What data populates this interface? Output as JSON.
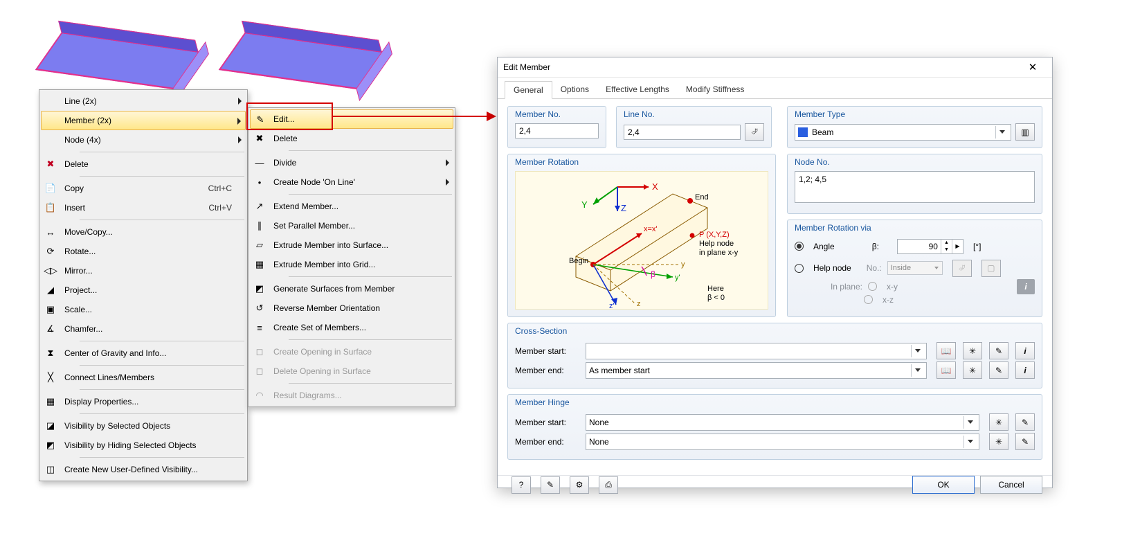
{
  "beams_count": 2,
  "context_menu_1": {
    "items": [
      {
        "label": "Line (2x)",
        "icon": "",
        "sub": true
      },
      {
        "label": "Member (2x)",
        "icon": "",
        "sub": true,
        "hover": true
      },
      {
        "label": "Node (4x)",
        "icon": "",
        "sub": true
      },
      {
        "sep": true
      },
      {
        "label": "Delete",
        "icon": "✖",
        "iconColor": "#C00020"
      },
      {
        "sep": true
      },
      {
        "label": "Copy",
        "icon": "📄",
        "accel": "Ctrl+C"
      },
      {
        "label": "Insert",
        "icon": "📋",
        "accel": "Ctrl+V"
      },
      {
        "sep": true
      },
      {
        "label": "Move/Copy...",
        "icon": "↔"
      },
      {
        "label": "Rotate...",
        "icon": "⟳"
      },
      {
        "label": "Mirror...",
        "icon": "◁▷"
      },
      {
        "label": "Project...",
        "icon": "◢"
      },
      {
        "label": "Scale...",
        "icon": "▣"
      },
      {
        "label": "Chamfer...",
        "icon": "∡"
      },
      {
        "sep": true
      },
      {
        "label": "Center of Gravity and Info...",
        "icon": "⧗"
      },
      {
        "sep": true
      },
      {
        "label": "Connect Lines/Members",
        "icon": "╳"
      },
      {
        "sep": true
      },
      {
        "label": "Display Properties...",
        "icon": "▦"
      },
      {
        "sep": true
      },
      {
        "label": "Visibility by Selected Objects",
        "icon": "◪"
      },
      {
        "label": "Visibility by Hiding Selected Objects",
        "icon": "◩"
      },
      {
        "sep": true
      },
      {
        "label": "Create New User-Defined Visibility...",
        "icon": "◫"
      }
    ]
  },
  "context_menu_2": {
    "items": [
      {
        "label": "Edit...",
        "icon": "✎",
        "hover": true
      },
      {
        "label": "Delete",
        "icon": "✖"
      },
      {
        "sep": true
      },
      {
        "label": "Divide",
        "icon": "—",
        "sub": true
      },
      {
        "label": "Create Node 'On Line'",
        "icon": "•",
        "sub": true
      },
      {
        "sep": true
      },
      {
        "label": "Extend Member...",
        "icon": "↗"
      },
      {
        "label": "Set Parallel Member...",
        "icon": "∥"
      },
      {
        "label": "Extrude Member into Surface...",
        "icon": "▱"
      },
      {
        "label": "Extrude Member into Grid...",
        "icon": "▦"
      },
      {
        "sep": true
      },
      {
        "label": "Generate Surfaces from Member",
        "icon": "◩"
      },
      {
        "label": "Reverse Member Orientation",
        "icon": "↺"
      },
      {
        "label": "Create Set of Members...",
        "icon": "≡"
      },
      {
        "sep": true
      },
      {
        "label": "Create Opening in Surface",
        "icon": "◻",
        "disabled": true
      },
      {
        "label": "Delete Opening in Surface",
        "icon": "◻",
        "disabled": true
      },
      {
        "sep": true
      },
      {
        "label": "Result Diagrams...",
        "icon": "◠",
        "disabled": true
      }
    ]
  },
  "dialog": {
    "title": "Edit Member",
    "tabs": [
      "General",
      "Options",
      "Effective Lengths",
      "Modify Stiffness"
    ],
    "active_tab": 0,
    "member_no_label": "Member No.",
    "member_no": "2,4",
    "line_no_label": "Line No.",
    "line_no": "2,4",
    "member_type_label": "Member Type",
    "member_type": "Beam",
    "node_no_label": "Node No.",
    "node_no": "1,2; 4,5",
    "rotation": {
      "legend": "Member Rotation via",
      "angle_label": "Angle",
      "beta_label": "β:",
      "angle_value": "90",
      "angle_unit": "[°]",
      "help_label": "Help node",
      "help_no_label": "No.:",
      "help_select": "Inside",
      "in_plane_label": "In plane:",
      "plane_xy": "x-y",
      "plane_xz": "x-z"
    },
    "rotation_diagram_legend": "Member Rotation",
    "diag_labels": {
      "x": "X",
      "y": "Y",
      "z": "Z",
      "begin": "Begin",
      "end": "End",
      "p": "P (X,Y,Z)",
      "help": "Help node",
      "inplane": "in plane x-y",
      "here": "Here",
      "beta": "β < 0",
      "zp": "z'",
      "yp": "y'",
      "b": "β",
      "xe": "x=x'"
    },
    "cross_section": {
      "legend": "Cross-Section",
      "start_label": "Member start:",
      "start_value": "",
      "end_label": "Member end:",
      "end_value": "As member start"
    },
    "hinge": {
      "legend": "Member Hinge",
      "start_label": "Member start:",
      "start_value": "None",
      "end_label": "Member end:",
      "end_value": "None"
    },
    "footer": {
      "ok": "OK",
      "cancel": "Cancel"
    }
  }
}
